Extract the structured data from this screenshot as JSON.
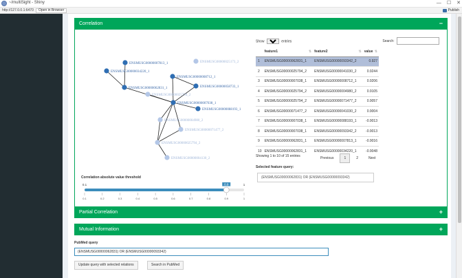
{
  "window": {
    "title": "~/multiSight - Shiny",
    "url": "http://127.0.0.1:6470",
    "open_browser": "Open in Browser",
    "publish": "Publish",
    "minimize": "—",
    "maximize": "☐",
    "close": "✕"
  },
  "colors": {
    "sidebar": "#222d32",
    "accent": "#00a65a",
    "node_dark": "#2f6eb3",
    "node_light": "#b4c7e7",
    "edge": "#222222",
    "slider": "#3c8dbc"
  },
  "correlation": {
    "title": "Correlation",
    "toggle": "−",
    "network": {
      "nodes": [
        {
          "label": "ENSMUSG00000007813_1",
          "tone": "dark"
        },
        {
          "label": "ENSMUSG00000034220_1",
          "tone": "dark"
        },
        {
          "label": "ENSMUSG00000062831_1",
          "tone": "dark"
        },
        {
          "label": "ENSMUSG00000025173_2",
          "tone": "light"
        },
        {
          "label": "ENSMUSG00000008712_1",
          "tone": "dark"
        },
        {
          "label": "ENSMUSG00000058733_1",
          "tone": "dark"
        },
        {
          "label": "ENSMUSG00000025794_2",
          "tone": "light"
        },
        {
          "label": "ENSMUSG00000007038_1",
          "tone": "dark"
        },
        {
          "label": "ENSMUSG00000088193_1",
          "tone": "dark"
        },
        {
          "label": "ENSMUSG00000004980_2",
          "tone": "light"
        },
        {
          "label": "ENSMUSG00000071477_2",
          "tone": "light"
        },
        {
          "label": "ENSMUSG00000025794_2",
          "tone": "light"
        },
        {
          "label": "ENSMUSG00000004130_2",
          "tone": "light"
        }
      ]
    },
    "threshold": {
      "label": "Correlation absolute value threshold",
      "min": "0.1",
      "max_label": "1",
      "value": "0.9",
      "ticks": [
        "0.1",
        "0.2",
        "0.3",
        "0.4",
        "0.5",
        "0.6",
        "0.7",
        "0.8",
        "0.9",
        "1"
      ]
    },
    "table": {
      "show_label": "Show",
      "show_value": "10",
      "entries_label": "entries",
      "search_label": "Search:",
      "columns": [
        "",
        "feature1",
        "feature2",
        "value"
      ],
      "rows": [
        {
          "idx": "1",
          "f1": "ENSMUSG00000062831_1",
          "f2": "ENSMUSG00000093342_2",
          "v": "0.927"
        },
        {
          "idx": "2",
          "f1": "ENSMUSG00000025794_2",
          "f2": "ENSMUSG00000041030_2",
          "v": "0.9244"
        },
        {
          "idx": "3",
          "f1": "ENSMUSG00000007038_1",
          "f2": "ENSMUSG00000008712_1",
          "v": "0.9206"
        },
        {
          "idx": "4",
          "f1": "ENSMUSG00000025794_2",
          "f2": "ENSMUSG00000004980_2",
          "v": "0.9105"
        },
        {
          "idx": "5",
          "f1": "ENSMUSG00000025794_2",
          "f2": "ENSMUSG00000071477_2",
          "v": "0.9057"
        },
        {
          "idx": "6",
          "f1": "ENSMUSG00000071477_2",
          "f2": "ENSMUSG00000041030_2",
          "v": "0.9004"
        },
        {
          "idx": "7",
          "f1": "ENSMUSG00000007038_1",
          "f2": "ENSMUSG00000088193_1",
          "v": "-0.9013"
        },
        {
          "idx": "8",
          "f1": "ENSMUSG00000007038_1",
          "f2": "ENSMUSG00000093342_2",
          "v": "-0.9013"
        },
        {
          "idx": "9",
          "f1": "ENSMUSG00000062831_1",
          "f2": "ENSMUSG00000007813_1",
          "v": "-0.9016"
        },
        {
          "idx": "10",
          "f1": "ENSMUSG00000062831_1",
          "f2": "ENSMUSG00000034220_1",
          "v": "-0.9048"
        }
      ],
      "info": "Showing 1 to 10 of 15 entries",
      "prev": "Previous",
      "pages": [
        "1",
        "2"
      ],
      "next": "Next"
    },
    "selected_label": "Selected feature query:",
    "selected_query": "(ENSMUSG00000062831) OR (ENSMUSG00000093342)"
  },
  "partial": {
    "title": "Partial Correlation",
    "toggle": "+"
  },
  "mutual": {
    "title": "Mutual Information",
    "toggle": "+"
  },
  "pubmed": {
    "label": "PubMed query",
    "value": "(ENSMUSG00000062831) OR (ENSMUSG00000093342)",
    "update_btn": "Update query with selected relations",
    "search_btn": "Search in PubMed"
  }
}
